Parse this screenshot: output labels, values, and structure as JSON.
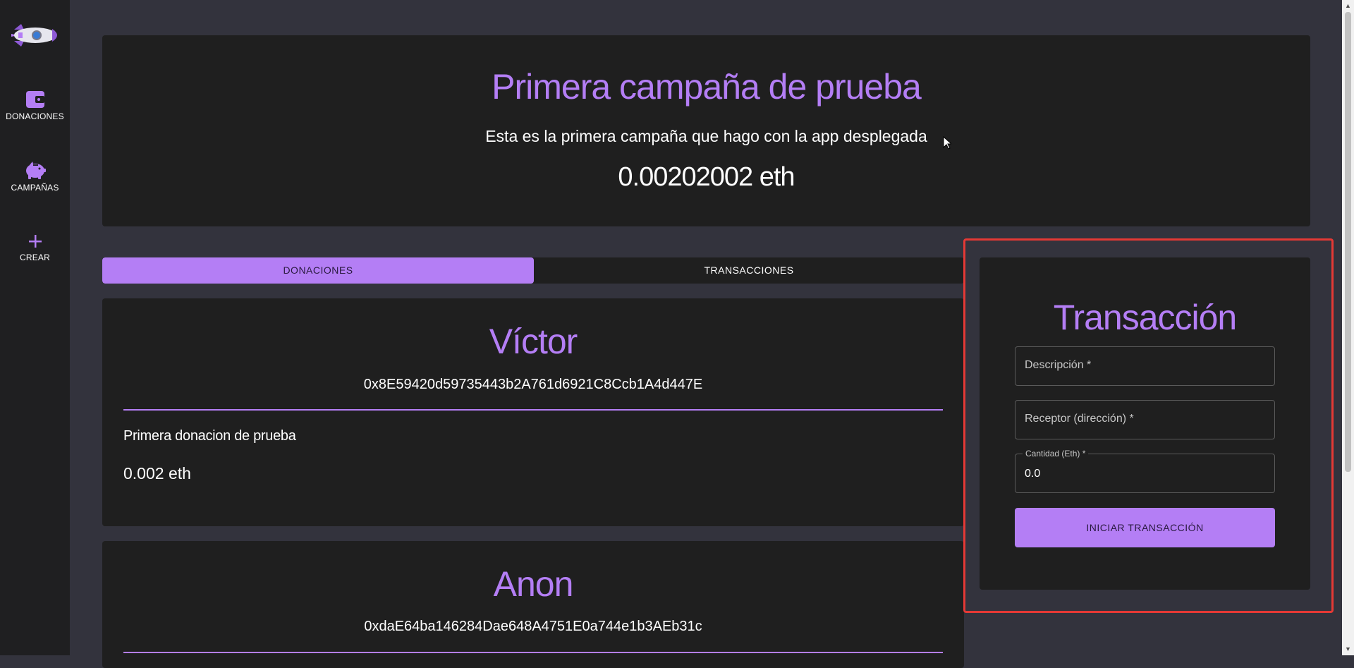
{
  "sidebar": {
    "logo_icon": "rocket-icon",
    "items": [
      {
        "label": "DONACIONES",
        "icon": "wallet-icon"
      },
      {
        "label": "CAMPAÑAS",
        "icon": "piggy-bank-icon"
      },
      {
        "label": "CREAR",
        "icon": "plus-icon"
      }
    ]
  },
  "campaign": {
    "title": "Primera campaña de prueba",
    "description": "Esta es la primera campaña que hago con la app desplegada",
    "amount": "0.00202002 eth"
  },
  "tabs": [
    {
      "label": "DONACIONES",
      "active": true
    },
    {
      "label": "TRANSACCIONES",
      "active": false
    }
  ],
  "donations": [
    {
      "name": "Víctor",
      "address": "0x8E59420d59735443b2A761d6921C8Ccb1A4d447E",
      "description": "Primera donacion de prueba",
      "amount": "0.002 eth"
    },
    {
      "name": "Anon",
      "address": "0xdaE64ba146284Dae648A4751E0a744e1b3AEb31c"
    }
  ],
  "transaction_form": {
    "title": "Transacción",
    "description_placeholder": "Descripción *",
    "receiver_placeholder": "Receptor (dirección) *",
    "amount_label": "Cantidad (Eth) *",
    "amount_value": "0.0",
    "submit_label": "INICIAR TRANSACCIÓN"
  },
  "colors": {
    "accent": "#b47ef5",
    "background": "#33333d",
    "card": "#1f1f1f",
    "sidebar": "#1f1f21",
    "highlight_border": "#e53935"
  }
}
